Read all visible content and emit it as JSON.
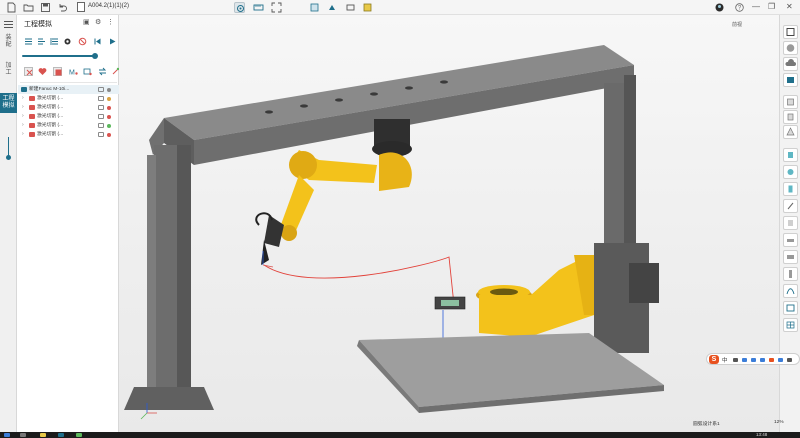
{
  "toolbar": {
    "document_name": "A004.2(1)(1)(2)",
    "minimize": "—",
    "restore": "❐",
    "close": "✕"
  },
  "rail": {
    "tabs": [
      "装配",
      "加工",
      "工程模拟"
    ],
    "active_tab": "工程模拟"
  },
  "panel": {
    "title": "工程模拟",
    "tree": [
      {
        "label": "新建Fanuc M-10i...",
        "status_color": "#8a8a8a"
      },
      {
        "label": "激光切割 (...",
        "status_color": "#d9a441"
      },
      {
        "label": "激光切割 (...",
        "status_color": "#d9534f"
      },
      {
        "label": "激光切割 (...",
        "status_color": "#d9534f"
      },
      {
        "label": "激光切割 (...",
        "status_color": "#5cb85c"
      },
      {
        "label": "激光切割 (...",
        "status_color": "#d9534f"
      }
    ]
  },
  "viewport": {
    "view_label": "前视",
    "robot_color": "#f5c518",
    "frame_color": "#6e6e6e",
    "path_color": "#e2423a"
  },
  "status": {
    "coord_label": "圆弧设计系1",
    "zoom": "12%"
  },
  "ime": {
    "text": "中"
  },
  "taskbar": {
    "time": "13:48"
  },
  "colors": {
    "accent": "#1f6f8b"
  }
}
